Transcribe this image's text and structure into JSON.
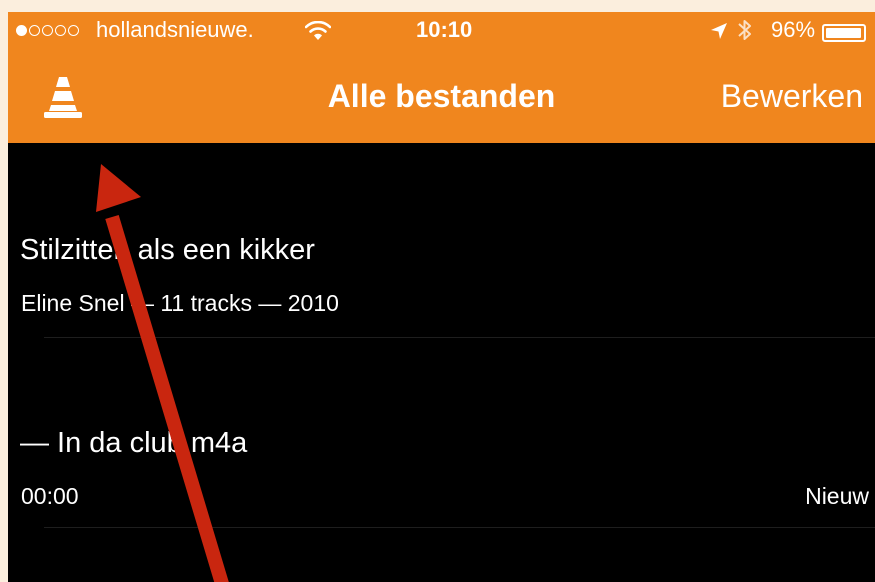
{
  "status_bar": {
    "signal_dots": [
      true,
      false,
      false,
      false,
      false
    ],
    "carrier": "hollandsnieuwe.",
    "wifi_icon": "wifi-icon",
    "time": "10:10",
    "location_icon": "location-arrow-icon",
    "bluetooth_icon": "bluetooth-icon",
    "battery_percent": "96%",
    "battery_level": 0.96
  },
  "nav_bar": {
    "logo_icon": "vlc-cone-icon",
    "title": "Alle bestanden",
    "edit_label": "Bewerken",
    "color": "#f0861e"
  },
  "items": [
    {
      "title": "Stilzitten als een kikker",
      "subtitle": "Eline Snel — 11 tracks — 2010",
      "badge": ""
    },
    {
      "title": "— In da club.m4a",
      "subtitle": "00:00",
      "badge": "Nieuw"
    }
  ],
  "annotation": {
    "arrow_color": "#c9260f"
  }
}
